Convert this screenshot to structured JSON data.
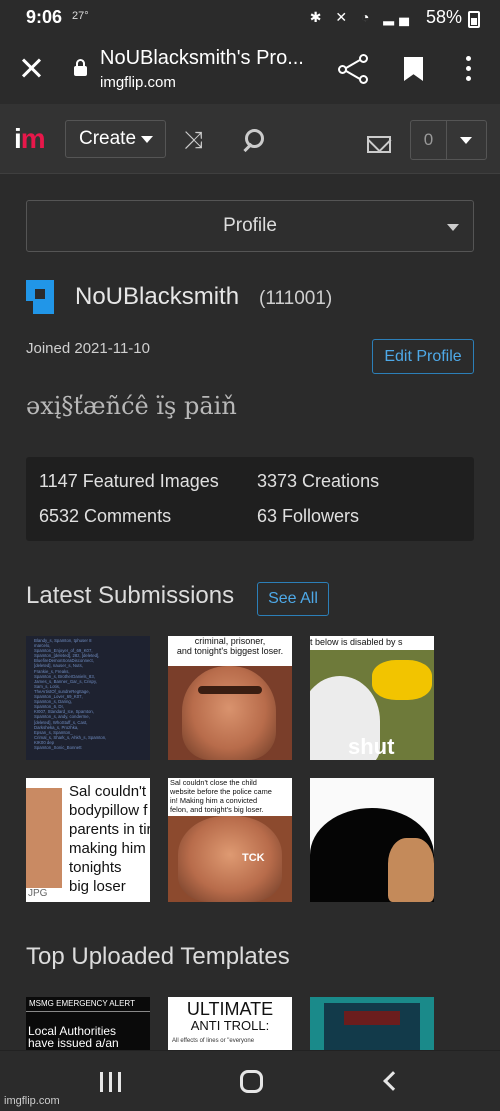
{
  "status_bar": {
    "time": "9:06",
    "temp": "27°",
    "icons": "✱ ✕ ◔ ▂▄",
    "battery": "58%"
  },
  "browser": {
    "page_title": "NoUBlacksmith's Pro...",
    "url": "imgflip.com"
  },
  "header": {
    "logo_i": "i",
    "logo_m": "m",
    "create_label": "Create",
    "notification_count": "0"
  },
  "profile": {
    "dropdown_label": "Profile",
    "username": "NoUBlacksmith",
    "points": "(111001)",
    "joined": "Joined 2021-11-10",
    "edit_label": "Edit Profile",
    "bio": "əxį§ťæñćê ïş pāiň",
    "stats": {
      "featured": "1147 Featured Images",
      "creations": "3373 Creations",
      "comments": "6532 Comments",
      "followers": "63 Followers"
    }
  },
  "latest": {
    "title": "Latest Submissions",
    "see_all": "See All",
    "thumbs": [
      {
        "caption": "Blandy_s, Spamton, tphuser 8\nmarcelo,\nSpamton_Enjoyer_of_69_K07,\nSpamton_[deleted], 28z, [deleted],\nBluefireDemonSoraDisconnect,\n[deleted], nauser_s, Nuts,\nFrankie_s, Freaks,\nSpamton_s, BrotherDaniels_83,\nJames_s, Banner_Gar_s, Crispy,\nSam_s, Lotis,\nTheArtistOf_sundreRegItage,\nSpamton_Lover_69_K07,\nSpamton_s, Daring,\nSpamton_6, DI,\nKI007, Standard_Ice, Spamton,\nSpamton_s, andy, conderme,\n[deleted], WhoStuff_s, Cast,\nDarksheka_s, Prozhka,\nEpsan_s, Spamton_\nCrimal_s, Shark_s, Ahkh_s, Spamton,\nKIK00 dep\nSpamton_Sonic_Bonnett"
      },
      {
        "caption": "criminal, prisoner,\nand tonight's biggest loser."
      },
      {
        "caption": "t below is disabled by s",
        "word": "shut"
      },
      {
        "caption": "Sal couldn't\nbodypillow f\nparents in tir\nmaking him\ntonights\nbig loser",
        "tag": "JPG"
      },
      {
        "caption": "Sal couldn't close the child\nwebsite before the police came\nin! Making him a convicted\nfelon, and tonight's big loser.",
        "tag": "TCK"
      },
      {
        "caption": ""
      }
    ]
  },
  "templates": {
    "title": "Top Uploaded Templates",
    "thumbs": [
      {
        "caption": "MSMG EMERGENCY ALERT",
        "body": "Local Authorities\nhave issued a/an"
      },
      {
        "caption": "ULTIMATE",
        "body": "ANTI TROLL:",
        "small": "All effects of  lines or \"everyone"
      },
      {
        "caption": ""
      }
    ]
  },
  "watermark": "imgflip.com"
}
